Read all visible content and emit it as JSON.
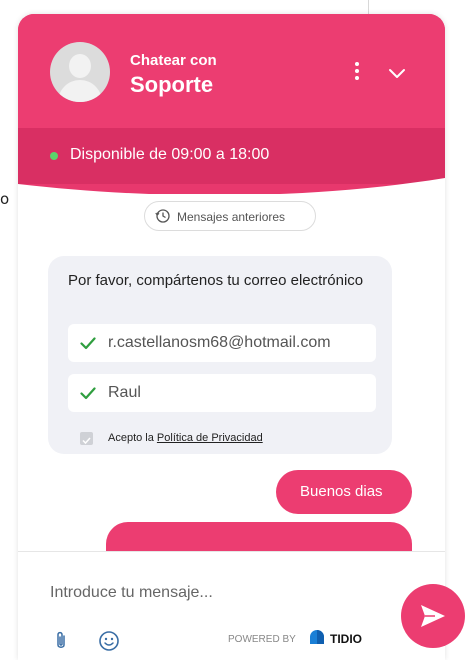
{
  "background": {
    "stray_char": "o"
  },
  "header": {
    "chat_with": "Chatear con",
    "agent_name": "Soporte",
    "menu_icon": "more-vertical-icon",
    "collapse_icon": "chevron-down-icon",
    "accent_color": "#ec3d71"
  },
  "availability": {
    "text": "Disponible de 09:00 a 18:00",
    "status_color": "#5bd46b"
  },
  "history": {
    "label": "Mensajes anteriores",
    "icon": "history-icon"
  },
  "form": {
    "prompt": "Por favor, compártenos tu correo electrónico",
    "email_value": "r.castellanosm68@hotmail.com",
    "name_value": "Raul",
    "consent_prefix": "Acepto la ",
    "consent_link": "Política de Privacidad",
    "consent_checked": true
  },
  "messages": [
    {
      "from": "user",
      "text": "Buenos dias"
    }
  ],
  "composer": {
    "placeholder": "Introduce tu mensaje...",
    "attach_icon": "paperclip-icon",
    "emoji_icon": "smiley-icon",
    "powered_by": "POWERED BY",
    "brand": "TIDIO",
    "send_icon": "send-icon"
  }
}
